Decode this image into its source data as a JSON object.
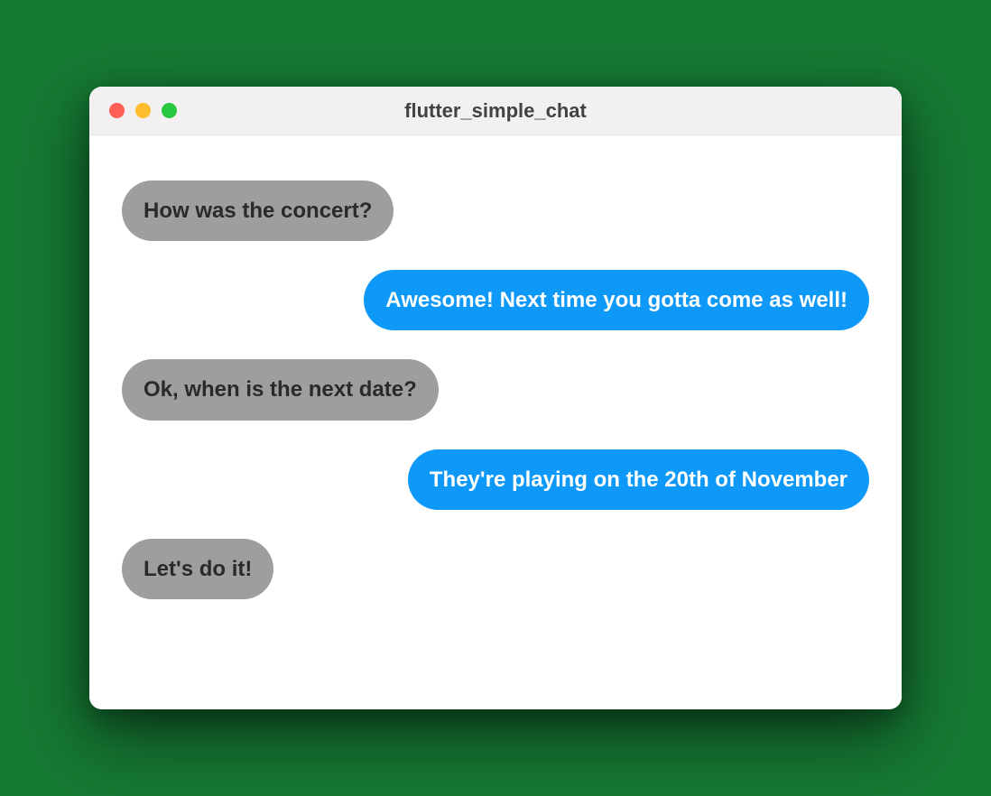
{
  "window": {
    "title": "flutter_simple_chat"
  },
  "messages": [
    {
      "side": "received",
      "text": "How was the concert?"
    },
    {
      "side": "sent",
      "text": "Awesome! Next time you gotta come as well!"
    },
    {
      "side": "received",
      "text": "Ok, when is the next date?"
    },
    {
      "side": "sent",
      "text": "They're playing on the 20th of November"
    },
    {
      "side": "received",
      "text": "Let's do it!"
    }
  ]
}
